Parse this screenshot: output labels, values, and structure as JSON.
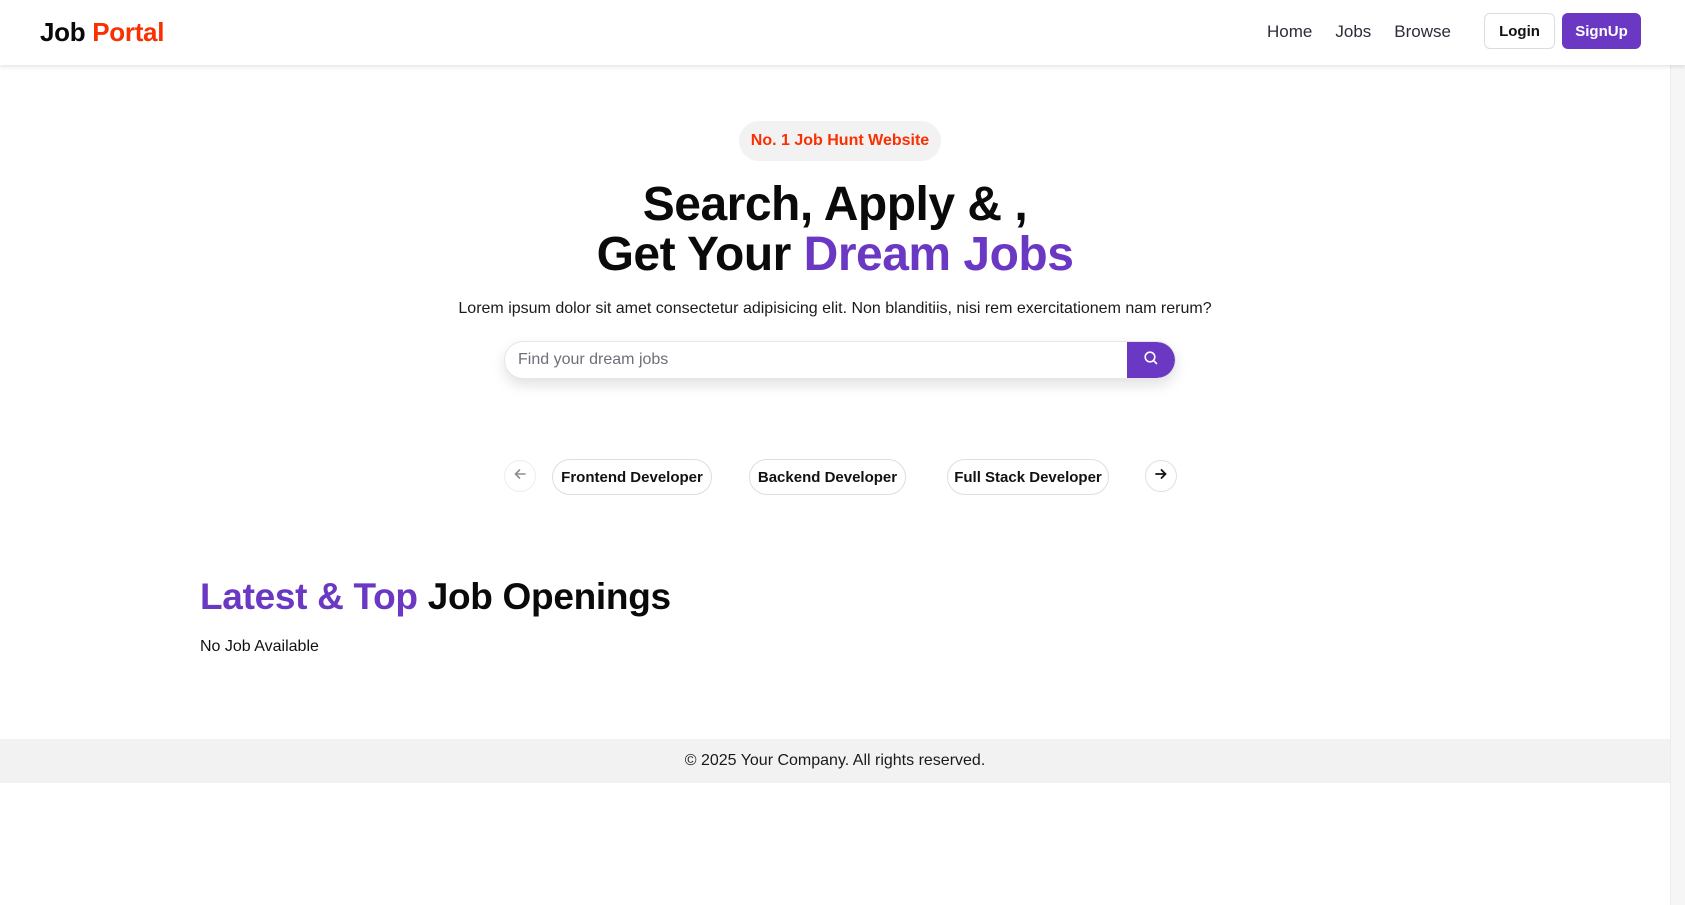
{
  "navbar": {
    "logo_part1": "Job ",
    "logo_part2": "Portal",
    "links": [
      "Home",
      "Jobs",
      "Browse"
    ],
    "login_label": "Login",
    "signup_label": "SignUp"
  },
  "hero": {
    "badge": "No. 1 Job Hunt Website",
    "headline_line1": "Search, Apply & ,",
    "headline_line2_plain": "Get Your ",
    "headline_line2_accent": "Dream Jobs",
    "subtext": "Lorem ipsum dolor sit amet consectetur adipisicing elit. Non blanditiis, nisi rem exercitationem nam rerum?",
    "search_placeholder": "Find your dream jobs",
    "search_value": ""
  },
  "categories": {
    "items": [
      "Frontend Developer",
      "Backend Developer",
      "Full Stack Developer"
    ]
  },
  "latest": {
    "title_accent": "Latest & Top",
    "title_plain": " Job Openings",
    "empty_text": "No Job Available"
  },
  "footer": {
    "text": "© 2025 Your Company. All rights reserved."
  },
  "icons": {
    "search": "search-icon",
    "prev": "arrow-left-icon",
    "next": "arrow-right-icon"
  },
  "colors": {
    "brand_purple": "#6a38c2",
    "brand_red": "#f83002",
    "footer_bg": "#f2f2f3"
  }
}
